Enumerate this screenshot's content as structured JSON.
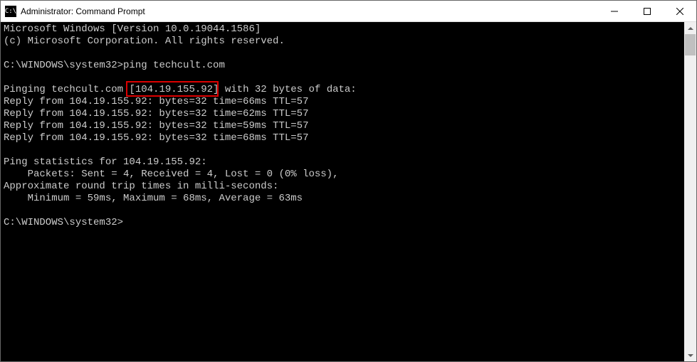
{
  "titlebar": {
    "icon_text": "C:\\",
    "title": "Administrator: Command Prompt"
  },
  "terminal": {
    "line1": "Microsoft Windows [Version 10.0.19044.1586]",
    "line2": "(c) Microsoft Corporation. All rights reserved.",
    "blank1": "",
    "prompt1_pre": "C:\\WINDOWS\\system32>",
    "prompt1_cmd": "ping techcult.com",
    "blank2": "",
    "ping_header_pre": "Pinging techcult.com ",
    "ping_ip": "[104.19.155.92]",
    "ping_header_post": " with 32 bytes of data:",
    "reply1": "Reply from 104.19.155.92: bytes=32 time=66ms TTL=57",
    "reply2": "Reply from 104.19.155.92: bytes=32 time=62ms TTL=57",
    "reply3": "Reply from 104.19.155.92: bytes=32 time=59ms TTL=57",
    "reply4": "Reply from 104.19.155.92: bytes=32 time=68ms TTL=57",
    "blank3": "",
    "stats1": "Ping statistics for 104.19.155.92:",
    "stats2": "    Packets: Sent = 4, Received = 4, Lost = 0 (0% loss),",
    "stats3": "Approximate round trip times in milli-seconds:",
    "stats4": "    Minimum = 59ms, Maximum = 68ms, Average = 63ms",
    "blank4": "",
    "prompt2": "C:\\WINDOWS\\system32>"
  }
}
